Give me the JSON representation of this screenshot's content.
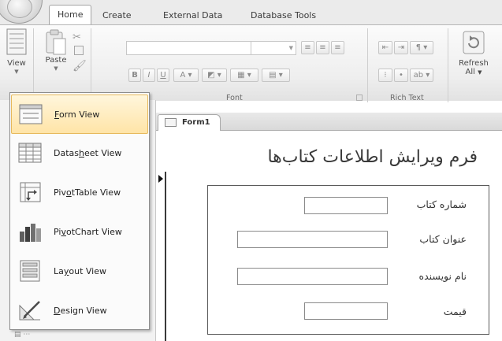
{
  "ribbon": {
    "tabs": [
      {
        "label": "Home",
        "active": true
      },
      {
        "label": "Create",
        "active": false
      },
      {
        "label": "External Data",
        "active": false
      },
      {
        "label": "Database Tools",
        "active": false
      }
    ],
    "view_button_label": "View",
    "paste_button_label": "Paste",
    "refresh_button_label": "Refresh",
    "refresh_button_sub": "All",
    "groups": {
      "font": "Font",
      "rich_text": "Rich Text"
    }
  },
  "view_menu": {
    "items": [
      {
        "icon": "form-view-icon",
        "pre": "",
        "accel": "F",
        "post": "orm View",
        "highlighted": true
      },
      {
        "icon": "datasheet-view-icon",
        "pre": "Datas",
        "accel": "h",
        "post": "eet View",
        "highlighted": false
      },
      {
        "icon": "pivottable-view-icon",
        "pre": "Piv",
        "accel": "o",
        "post": "tTable View",
        "highlighted": false
      },
      {
        "icon": "pivotchart-view-icon",
        "pre": "Pi",
        "accel": "v",
        "post": "otChart View",
        "highlighted": false
      },
      {
        "icon": "layout-view-icon",
        "pre": "La",
        "accel": "y",
        "post": "out View",
        "highlighted": false
      },
      {
        "icon": "design-view-icon",
        "pre": "",
        "accel": "D",
        "post": "esign View",
        "highlighted": false
      }
    ]
  },
  "document": {
    "tab_label": "Form1",
    "form_title": "فرم ویرایش اطلاعات کتاب‌ها",
    "fields": [
      {
        "label": "شماره کتاب",
        "value": ""
      },
      {
        "label": "عنوان کتاب",
        "value": ""
      },
      {
        "label": "نام نویسنده",
        "value": ""
      },
      {
        "label": "قیمت",
        "value": ""
      }
    ]
  }
}
